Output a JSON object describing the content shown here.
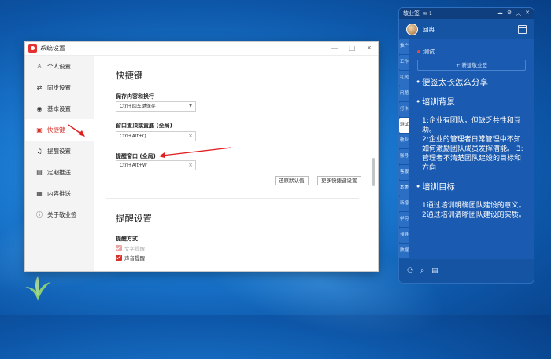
{
  "settings_window": {
    "title": "系统设置",
    "controls": {
      "minimize": "—",
      "maximize": "□",
      "close": "✕"
    },
    "sidebar": [
      {
        "label": "个人设置",
        "icon": "user-icon",
        "glyph": "♙"
      },
      {
        "label": "同步设置",
        "icon": "sync-icon",
        "glyph": "⇄"
      },
      {
        "label": "基本设置",
        "icon": "settings-icon",
        "glyph": "◉"
      },
      {
        "label": "快捷键",
        "icon": "shortcut-icon",
        "glyph": "▣",
        "active": true
      },
      {
        "label": "提醒设置",
        "icon": "bell-icon",
        "glyph": "♫"
      },
      {
        "label": "定期推送",
        "icon": "schedule-icon",
        "glyph": "▤"
      },
      {
        "label": "内容推送",
        "icon": "content-icon",
        "glyph": "▦"
      },
      {
        "label": "关于敬业签",
        "icon": "info-icon",
        "glyph": "ⓘ"
      }
    ],
    "shortcut": {
      "heading": "快捷键",
      "save_label": "保存内容和换行",
      "save_value": "Ctrl+回车键保存",
      "topmost_label": "窗口置顶或置底 (全局)",
      "topmost_value": "Ctrl+Alt+Q",
      "remind_label": "提醒窗口 (全局)",
      "remind_value": "Ctrl+Alt+W",
      "restore_button": "还原默认值",
      "more_button": "更多快捷键设置"
    },
    "reminder": {
      "heading": "提醒设置",
      "method_label": "提醒方式",
      "text_reminder": "文字提醒",
      "sound_reminder": "声音提醒"
    }
  },
  "note_panel": {
    "app_name": "敬业签",
    "badge": "1",
    "user_name": "回冉",
    "section": "测试",
    "new_button": "+ 新建敬业签",
    "tabs": [
      "推广",
      "工作",
      "礼包",
      "问题",
      "打卡",
      "测试",
      "敬业",
      "账号",
      "客服",
      "本美",
      "新增",
      "学习",
      "领导",
      "数据"
    ],
    "active_tab": 5,
    "content": {
      "item1": "便签太长怎么分享",
      "item2": "培训背景",
      "para1": "1:企业有团队，但缺乏共性和互助。",
      "para2": "2:企业的管理者日常管理中不知如何激励团队成员发挥潜能。 3:管理者不清楚团队建设的目标和方向",
      "item3": "培训目标",
      "para3": "1通过培训明确团队建设的意义。",
      "para4": "2通过培训清晰团队建设的实质。"
    }
  },
  "colors": {
    "accent": "#d9302a",
    "panel_bg": "#1557a8",
    "desktop": "#1a78cf"
  }
}
